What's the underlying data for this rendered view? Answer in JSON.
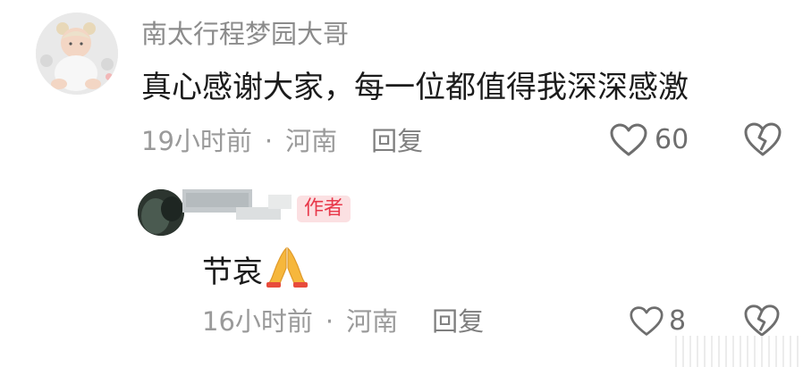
{
  "comment_main": {
    "username": "南太行程梦园大哥",
    "text": "真心感谢大家，每一位都值得我深深感激",
    "time": "19小时前",
    "separator": "·",
    "location": "河南",
    "reply_label": "回复",
    "like_count": "60",
    "like_icon": "heart-outline-icon",
    "dislike_icon": "broken-heart-icon"
  },
  "comment_reply": {
    "author_badge": "作者",
    "text": "节哀",
    "emoji_icon": "praying-hands-icon",
    "time": "16小时前",
    "separator": "·",
    "location": "河南",
    "reply_label": "回复",
    "like_count": "8",
    "like_icon": "heart-outline-icon",
    "dislike_icon": "broken-heart-icon"
  },
  "colors": {
    "text_primary": "#1b1b1b",
    "text_secondary": "#9a9a9a",
    "author_badge_bg": "#fbe0e2",
    "author_badge_fg": "#e8384a",
    "emoji_yellow": "#f6b73c"
  }
}
